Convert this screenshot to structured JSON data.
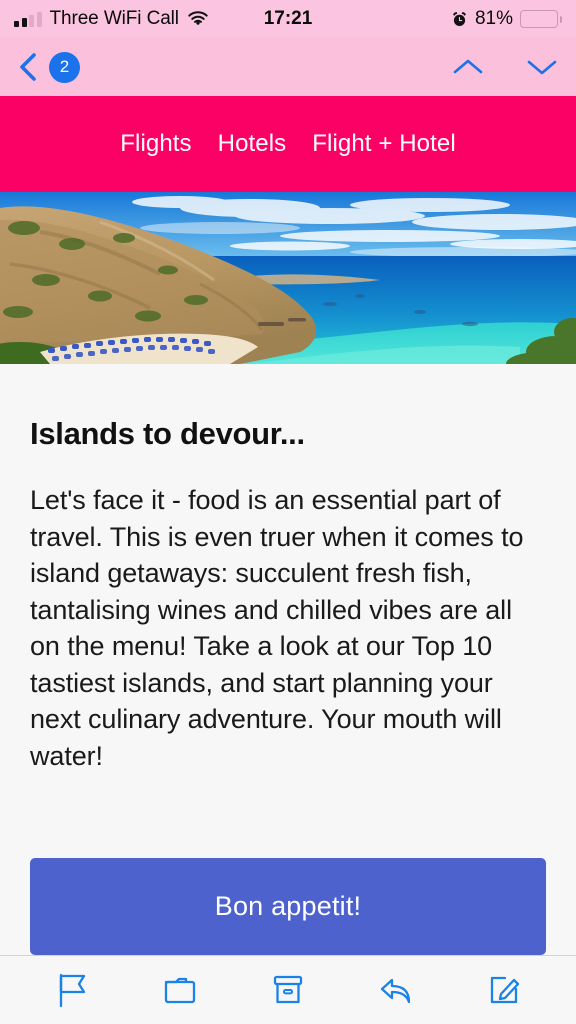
{
  "status_bar": {
    "signal_icon": "signal-bars-icon",
    "carrier": "Three WiFi Call",
    "wifi_icon": "wifi-icon",
    "time": "17:21",
    "alarm_icon": "alarm-clock-icon",
    "battery_percent": "81%",
    "battery_icon": "battery-icon"
  },
  "nav_bar": {
    "back_icon": "chevron-left-icon",
    "unread_badge": "2",
    "prev_icon": "chevron-up-icon",
    "next_icon": "chevron-down-icon",
    "background_color": "#FBC0DC",
    "tint_color": "#1B72EA"
  },
  "email": {
    "brand_nav": {
      "background_color": "#FB0166",
      "items": [
        {
          "label": "Flights"
        },
        {
          "label": "Hotels"
        },
        {
          "label": "Flight + Hotel"
        }
      ]
    },
    "hero_image": {
      "alt": "coastal-bay-with-beach-umbrellas",
      "sky_color": "#1E8FE0",
      "deep_sea_color": "#0E6FC4",
      "shallow_sea_color": "#1FD6D2",
      "cliff_color": "#C9AB79",
      "sand_color": "#F2E6D2"
    },
    "headline": "Islands to devour...",
    "body": "Let's face it - food is an essential part of travel. This is even truer when it comes to island getaways: succulent fresh fish, tantalising wines and chilled vibes are all on the menu! Take a look at our Top 10 tastiest islands, and start planning your next culinary adventure. Your mouth will water!",
    "cta": {
      "label": "Bon appetit!",
      "background_color": "#4E62CE"
    }
  },
  "toolbar": {
    "items": [
      {
        "icon": "flag-icon"
      },
      {
        "icon": "folder-icon"
      },
      {
        "icon": "archive-box-icon"
      },
      {
        "icon": "reply-arrow-icon"
      },
      {
        "icon": "compose-icon"
      }
    ],
    "tint_color": "#1B82E8"
  }
}
